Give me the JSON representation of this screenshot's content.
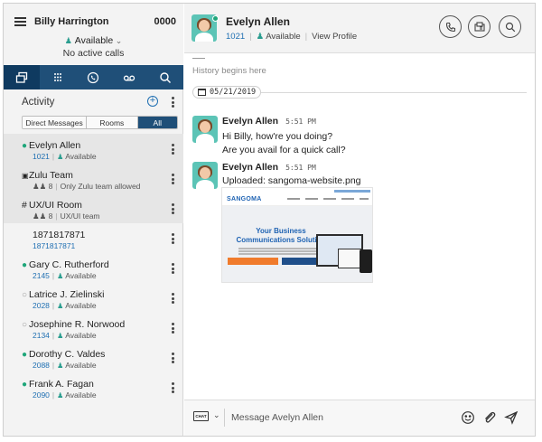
{
  "user": {
    "name": "Billy Harrington",
    "extension": "0000",
    "status": "Available",
    "calls": "No active calls"
  },
  "toolbar": {
    "icons": [
      "chat-window-icon",
      "dialpad-icon",
      "phone-history-icon",
      "voicemail-icon",
      "search-icon"
    ]
  },
  "activity": {
    "title": "Activity",
    "filters": [
      "Direct Messages",
      "Rooms",
      "All"
    ],
    "selected_filter": "All"
  },
  "contacts": [
    {
      "prefix": "•",
      "name": "Evelyn Allen",
      "num": "1021",
      "detail": "Available",
      "selected": true
    },
    {
      "prefix": "🔒",
      "name": "Zulu Team",
      "num": "8",
      "detail": "Only Zulu team allowed",
      "selected": true
    },
    {
      "prefix": "#",
      "name": "UX/UI Room",
      "num": "8",
      "detail": "UX/UI team",
      "selected": true
    },
    {
      "prefix": "",
      "name": "1871817871",
      "num": "1871817871",
      "detail": "",
      "selected": false
    },
    {
      "prefix": "•",
      "name": "Gary C. Rutherford",
      "num": "2145",
      "detail": "Available",
      "selected": false
    },
    {
      "prefix": "○",
      "name": "Latrice J. Zielinski",
      "num": "2028",
      "detail": "Available",
      "selected": false
    },
    {
      "prefix": "○",
      "name": "Josephine R. Norwood",
      "num": "2134",
      "detail": "Available",
      "selected": false
    },
    {
      "prefix": "•",
      "name": "Dorothy C. Valdes",
      "num": "2088",
      "detail": "Available",
      "selected": false
    },
    {
      "prefix": "•",
      "name": "Frank A. Fagan",
      "num": "2090",
      "detail": "Available",
      "selected": false
    }
  ],
  "chat": {
    "contact_name": "Evelyn Allen",
    "contact_ext": "1021",
    "contact_status": "Available",
    "view_profile": "View Profile",
    "history": "History begins here",
    "date": "05/21/2019",
    "messages": [
      {
        "author": "Evelyn Allen",
        "time": "5:51 PM",
        "lines": [
          "Hi Billy, how're you doing?",
          "Are you avail for a quick call?"
        ]
      },
      {
        "author": "Evelyn Allen",
        "time": "5:51 PM",
        "lines": [
          "Uploaded: sangoma-website.png"
        ]
      }
    ],
    "preview": {
      "logo": "SANGOMA",
      "headline": "Your Business Communications Solution"
    }
  },
  "composer": {
    "type_label": "CHAT",
    "placeholder": "Message Avelyn Allen"
  },
  "colors": {
    "navy": "#1f4f78",
    "accent_blue": "#1f6fb2",
    "status_green": "#1fa67a"
  }
}
